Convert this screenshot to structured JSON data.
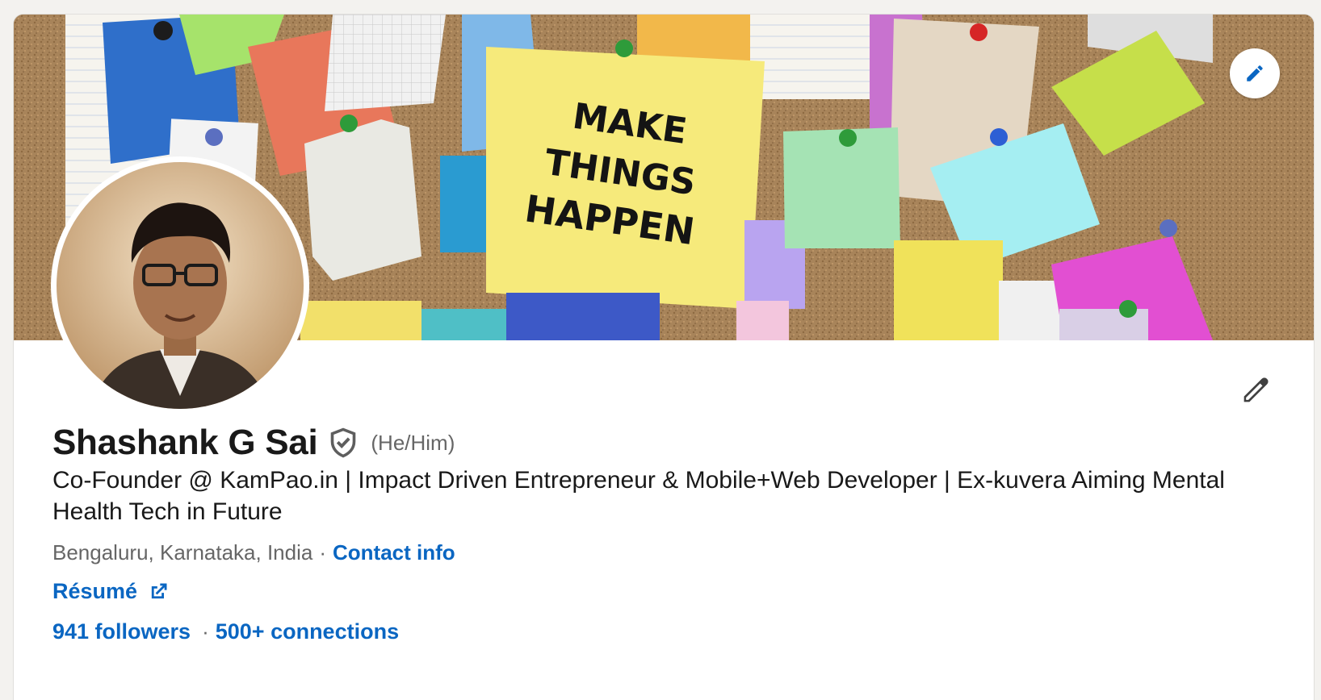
{
  "banner": {
    "note_text": [
      "MAKE",
      "THINGS",
      "HAPPEN"
    ],
    "edit_icon": "pencil-icon"
  },
  "profile": {
    "name": "Shashank G Sai",
    "verified_icon": "verified-shield-icon",
    "pronouns": "(He/Him)",
    "headline": "Co-Founder @ KamPao.in | Impact Driven Entrepreneur & Mobile+Web Developer | Ex-kuvera Aiming Mental Health Tech in Future",
    "location": "Bengaluru, Karnataka, India",
    "separator": "·",
    "contact_label": "Contact info",
    "resume_label": "Résumé",
    "resume_icon": "external-link-icon",
    "followers": "941 followers",
    "connections": "500+ connections"
  },
  "colors": {
    "link": "#0a66c2",
    "muted": "#666666",
    "text": "#191919"
  }
}
